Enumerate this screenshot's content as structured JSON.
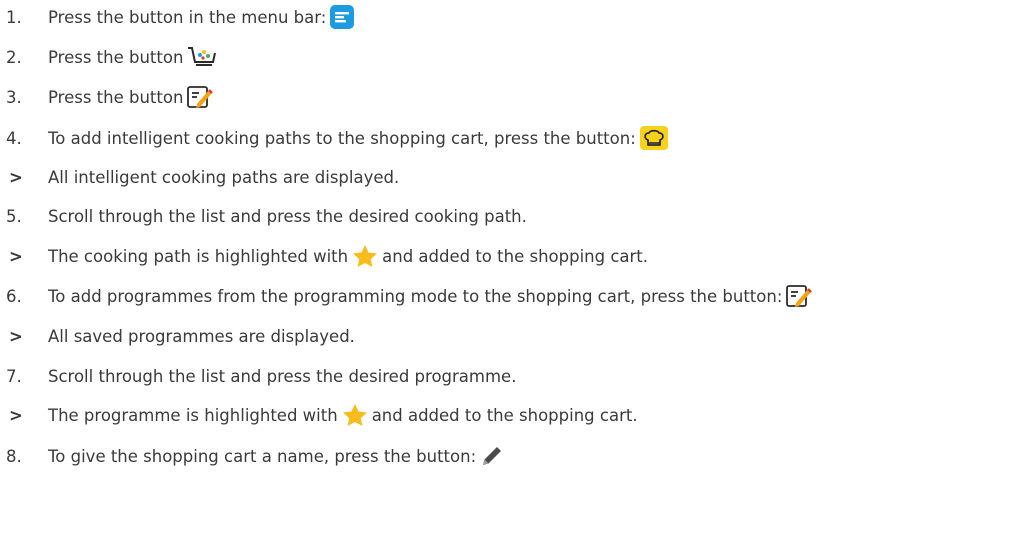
{
  "steps": [
    {
      "number": "1.",
      "text": "Press the button in the menu bar:",
      "icon": "menu-icon"
    },
    {
      "number": "2.",
      "text": "Press the button",
      "icon": "shopping-cart-icon"
    },
    {
      "number": "3.",
      "text": "Press the button",
      "icon": "programming-edit-icon"
    },
    {
      "number": "4.",
      "text": "To add intelligent cooking paths to the shopping cart, press the button:",
      "icon": "chef-hat-icon"
    },
    {
      "result": ">",
      "text": "All intelligent cooking paths are displayed."
    },
    {
      "number": "5.",
      "text": "Scroll through the list and press the desired cooking path."
    },
    {
      "result": ">",
      "text_before": "The cooking path is highlighted with",
      "icon": "star-icon",
      "text_after": "and added to the shopping cart."
    },
    {
      "number": "6.",
      "text": "To add programmes from the programming mode to the shopping cart, press the button:",
      "icon": "programming-edit-icon"
    },
    {
      "result": ">",
      "text": "All saved programmes are displayed."
    },
    {
      "number": "7.",
      "text": "Scroll through the list and press the desired programme."
    },
    {
      "result": ">",
      "text_before": "The programme is highlighted with",
      "icon": "star-icon",
      "text_after": "and added to the shopping cart."
    },
    {
      "number": "8.",
      "text": "To give the shopping cart a name, press the button:",
      "icon": "pencil-icon"
    }
  ],
  "colors": {
    "text": "#3a3a3a",
    "menu_button": "#1e9be0",
    "chef_button": "#f7d21b",
    "star": "#f9bc1d",
    "edit_pencil": "#f3a416"
  }
}
